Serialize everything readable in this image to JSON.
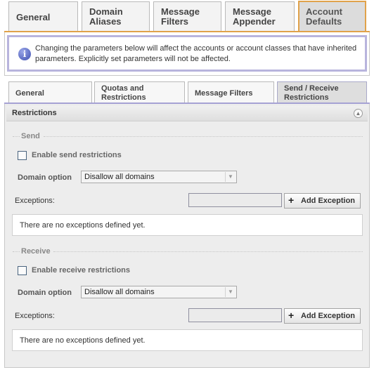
{
  "top_tabs": [
    {
      "line1": "General",
      "line2": ""
    },
    {
      "line1": "Domain",
      "line2": "Aliases"
    },
    {
      "line1": "Message",
      "line2": "Filters"
    },
    {
      "line1": "Message",
      "line2": "Appender"
    },
    {
      "line1": "Account",
      "line2": "Defaults"
    }
  ],
  "info": {
    "icon": "info-icon",
    "text": "Changing the parameters below will affect the accounts or account classes that have inherited parameters. Explicitly set parameters will not be affected."
  },
  "sub_tabs": [
    {
      "line1": "General",
      "line2": ""
    },
    {
      "line1": "Quotas and",
      "line2": "Restrictions"
    },
    {
      "line1": "Message Filters",
      "line2": ""
    },
    {
      "line1": "Send / Receive",
      "line2": "Restrictions"
    }
  ],
  "panel": {
    "title": "Restrictions",
    "collapse_icon": "collapse-icon"
  },
  "send": {
    "legend": "Send",
    "checkbox_label": "Enable send restrictions",
    "checked": false,
    "domain_option_label": "Domain option",
    "domain_option_value": "Disallow all domains",
    "exceptions_label": "Exceptions:",
    "exception_input_value": "",
    "add_button_label": "Add Exception",
    "add_button_icon": "+",
    "empty_text": "There are no exceptions defined yet."
  },
  "receive": {
    "legend": "Receive",
    "checkbox_label": "Enable receive restrictions",
    "checked": false,
    "domain_option_label": "Domain option",
    "domain_option_value": "Disallow all domains",
    "exceptions_label": "Exceptions:",
    "exception_input_value": "",
    "add_button_label": "Add Exception",
    "add_button_icon": "+",
    "empty_text": "There are no exceptions defined yet."
  },
  "colors": {
    "active_tab_border": "#e0a24a",
    "info_border": "#b8b4dd",
    "subtab_line": "#a6a2d4"
  }
}
